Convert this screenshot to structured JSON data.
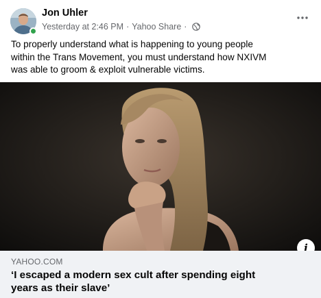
{
  "post": {
    "author": "Jon Uhler",
    "timestamp": "Yesterday at 2:46 PM",
    "separator": "·",
    "source": "Yahoo Share",
    "privacy_icon": "globe-icon",
    "more_icon": "more-options-icon",
    "text_lines": [
      "To properly understand what is happening to young people",
      "within the Trans Movement, you must understand how NXIVM",
      "was able to groom & exploit vulnerable victims."
    ]
  },
  "link": {
    "domain": "YAHOO.COM",
    "title_lines": [
      "‘I escaped a modern sex cult after spending eight",
      "years as their slave’"
    ],
    "info_label": "i"
  },
  "colors": {
    "online": "#31a24c",
    "secondary_text": "#65676b",
    "link_background": "#f0f2f5"
  }
}
